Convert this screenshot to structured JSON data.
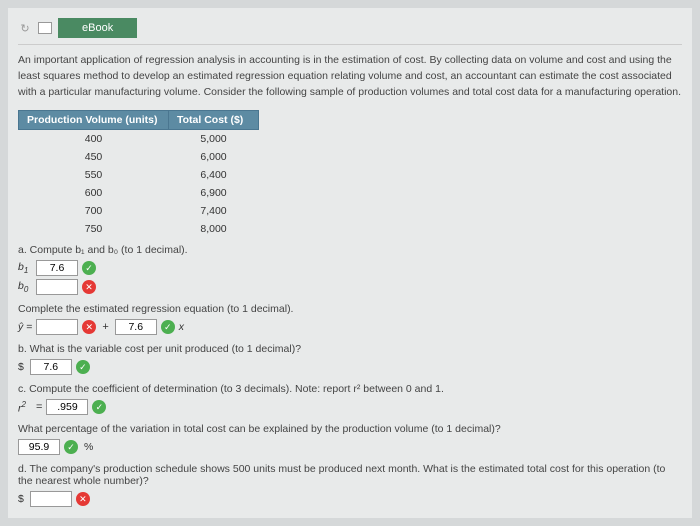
{
  "header": {
    "ebook_label": "eBook"
  },
  "intro": "An important application of regression analysis in accounting is in the estimation of cost. By collecting data on volume and cost and using the least squares method to develop an estimated regression equation relating volume and cost, an accountant can estimate the cost associated with a particular manufacturing volume. Consider the following sample of production volumes and total cost data for a manufacturing operation.",
  "table": {
    "col1": "Production Volume (units)",
    "col2": "Total Cost ($)",
    "rows": [
      {
        "vol": "400",
        "cost": "5,000"
      },
      {
        "vol": "450",
        "cost": "6,000"
      },
      {
        "vol": "550",
        "cost": "6,400"
      },
      {
        "vol": "600",
        "cost": "6,900"
      },
      {
        "vol": "700",
        "cost": "7,400"
      },
      {
        "vol": "750",
        "cost": "8,000"
      }
    ]
  },
  "qa": {
    "a": {
      "prompt": "a. Compute b₁ and b₀ (to 1 decimal).",
      "b1_label": "b",
      "b1_sub": "1",
      "b1_val": "7.6",
      "b0_label": "b",
      "b0_sub": "0",
      "b0_val": ""
    },
    "complete": {
      "prompt": "Complete the estimated regression equation (to 1 decimal).",
      "yhat": "ŷ =",
      "int_val": "",
      "slope_val": "7.6",
      "x": "x"
    },
    "b": {
      "prompt": "b. What is the variable cost per unit produced (to 1 decimal)?",
      "val": "7.6"
    },
    "c": {
      "prompt": "c. Compute the coefficient of determination (to 3 decimals). Note: report r² between 0 and 1.",
      "r2": "r",
      "r2sup": "2",
      "eq": "=",
      "val": ".959"
    },
    "cpct": {
      "prompt": "What percentage of the variation in total cost can be explained by the production volume (to 1 decimal)?",
      "val": "95.9",
      "pct": "%"
    },
    "d": {
      "prompt": "d. The company's production schedule shows 500 units must be produced next month. What is the estimated total cost for this operation (to the nearest whole number)?",
      "val": ""
    }
  },
  "chart_data": {
    "type": "table",
    "title": "Production Volume vs Total Cost",
    "columns": [
      "Production Volume (units)",
      "Total Cost ($)"
    ],
    "data": [
      [
        400,
        5000
      ],
      [
        450,
        6000
      ],
      [
        550,
        6400
      ],
      [
        600,
        6900
      ],
      [
        700,
        7400
      ],
      [
        750,
        8000
      ]
    ]
  }
}
